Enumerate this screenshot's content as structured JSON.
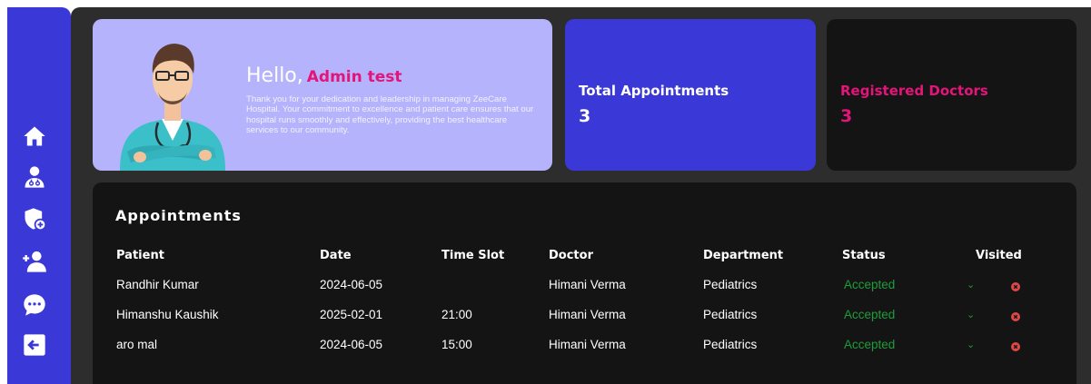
{
  "sidebar": {
    "items": [
      {
        "icon": "home-icon"
      },
      {
        "icon": "doctor-icon"
      },
      {
        "icon": "add-doctor-icon"
      },
      {
        "icon": "add-admin-icon"
      },
      {
        "icon": "messages-icon"
      },
      {
        "icon": "logout-icon"
      }
    ]
  },
  "welcome": {
    "greeting": "Hello,",
    "name": "Admin test",
    "message": "Thank you for your dedication and leadership in managing ZeeCare Hospital. Your commitment to excellence and patient care ensures that our hospital runs smoothly and effectively, providing the best healthcare services to our community."
  },
  "stats": {
    "total_appointments": {
      "label": "Total Appointments",
      "value": "3"
    },
    "registered_doctors": {
      "label": "Registered Doctors",
      "value": "3"
    }
  },
  "appointments": {
    "title": "Appointments",
    "headers": [
      "Patient",
      "Date",
      "Time Slot",
      "Doctor",
      "Department",
      "Status",
      "Visited"
    ],
    "rows": [
      {
        "patient": "Randhir Kumar",
        "date": "2024-06-05",
        "time": "",
        "doctor": "Himani Verma",
        "department": "Pediatrics",
        "status": "Accepted"
      },
      {
        "patient": "Himanshu Kaushik",
        "date": "2025-02-01",
        "time": "21:00",
        "doctor": "Himani Verma",
        "department": "Pediatrics",
        "status": "Accepted"
      },
      {
        "patient": "aro mal",
        "date": "2024-06-05",
        "time": "15:00",
        "doctor": "Himani Verma",
        "department": "Pediatrics",
        "status": "Accepted"
      }
    ]
  },
  "colors": {
    "accent": "#3a38d6",
    "highlight": "#e3157a",
    "status_accepted": "#1f9d3a",
    "not_visited": "#e04848"
  }
}
